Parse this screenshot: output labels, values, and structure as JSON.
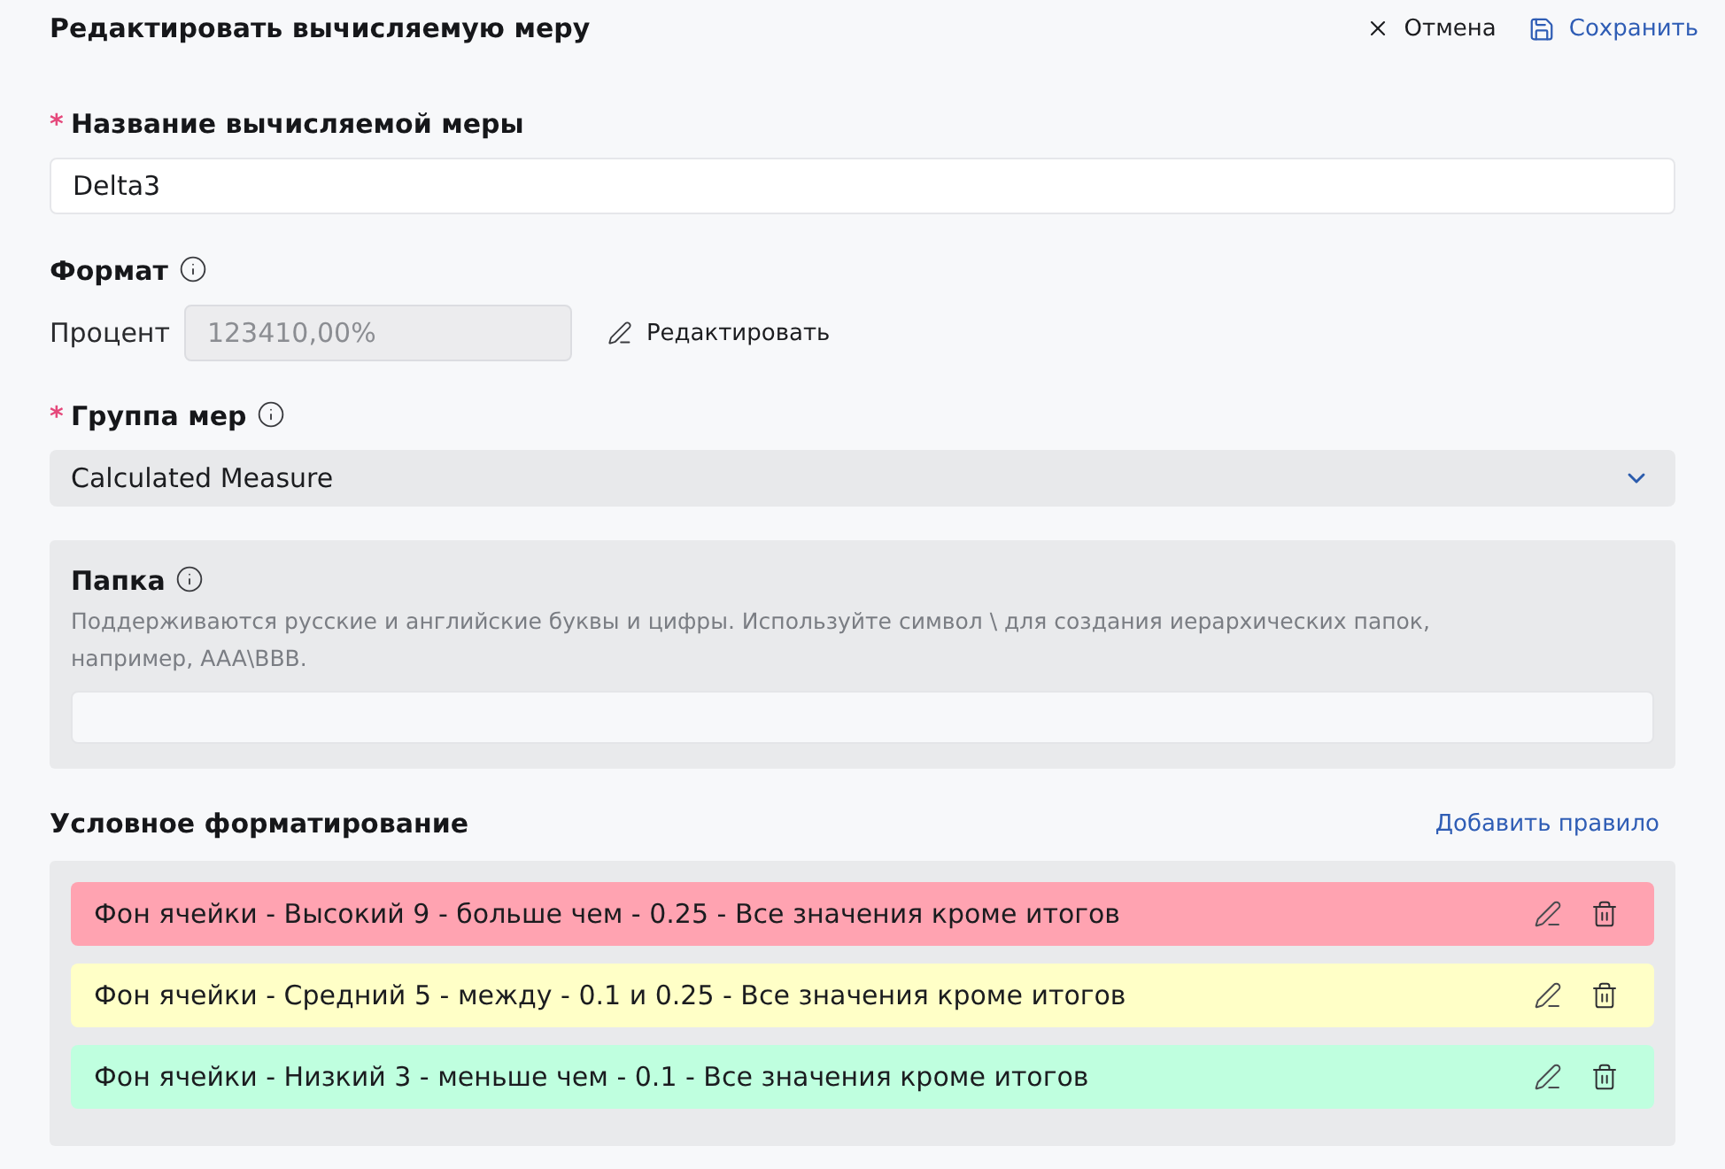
{
  "header": {
    "title": "Редактировать вычисляемую меру",
    "actions": [
      {
        "kind": "cancel",
        "label": "Отмена"
      },
      {
        "kind": "save",
        "label": "Сохранить"
      }
    ]
  },
  "name_field": {
    "required_mark": "*",
    "label": "Название вычисляемой меры",
    "value": "Delta3"
  },
  "format": {
    "label": "Формат",
    "info": true,
    "type": "Процент",
    "preview": "123410,00%",
    "edit_button": "Редактировать"
  },
  "measure_group": {
    "required_mark": "*",
    "label": "Группа мер",
    "info": true,
    "value": "Calculated Measure"
  },
  "folder": {
    "label": "Папка",
    "info": true,
    "hint": "Поддерживаются русские и английские буквы и цифры. Используйте символ \\ для создания иерархических папок, например, AAA\\BBB."
  },
  "conditional_formatting": {
    "title": "Условное форматирование",
    "add_rule": "Добавить правило",
    "rules": [
      {
        "text": "Фон ячейки - Высокий 9 - больше чем - 0.25 - Все значения кроме итогов",
        "color": "#ffa3b1"
      },
      {
        "text": "Фон ячейки - Средний 5 - между - 0.1 и 0.25 - Все значения кроме итогов",
        "color": "#ffffc7"
      },
      {
        "text": "Фон ячейки - Низкий 3 - меньше чем - 0.1 - Все значения кроме итогов",
        "color": "#bfffdf"
      }
    ]
  }
}
